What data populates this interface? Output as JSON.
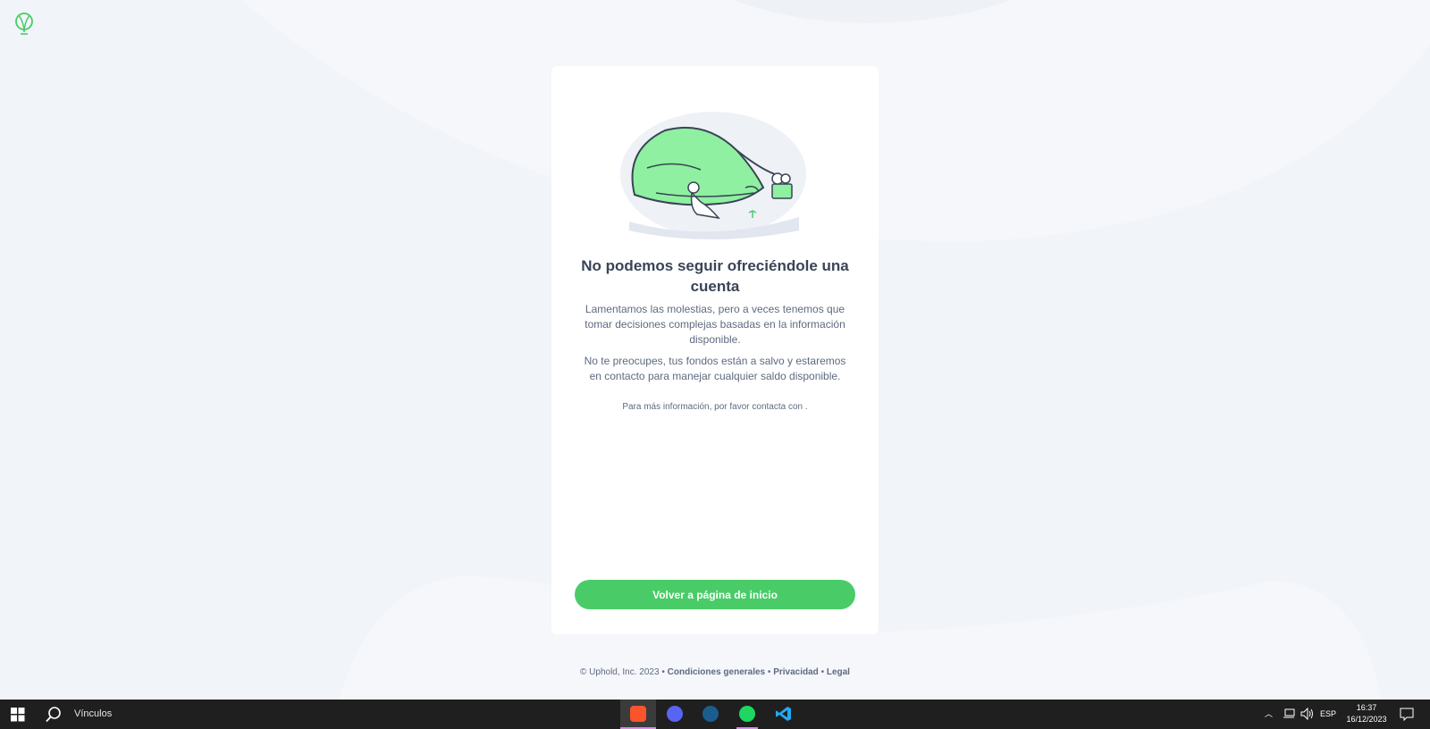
{
  "brand": {
    "name": "Uphold",
    "accent": "#49cc68"
  },
  "card": {
    "title": "No podemos seguir ofreciéndole una cuenta",
    "paragraph1": "Lamentamos las molestias, pero a veces tenemos que tomar decisiones complejas basadas en la información disponible.",
    "paragraph2": "No te preocupes, tus fondos están a salvo y estaremos en contacto para manejar cualquier saldo disponible.",
    "contact_note": "Para más información, por favor contacta con .",
    "button_label": "Volver a página de inicio"
  },
  "footer": {
    "copyright": "© Uphold, Inc. 2023",
    "separator": "•",
    "links": [
      "Condiciones generales",
      "Privacidad",
      "Legal"
    ]
  },
  "taskbar": {
    "search_label": "Vínculos",
    "apps": [
      {
        "name": "brave",
        "icon": "brave-icon",
        "color": "#fb542b",
        "active": true
      },
      {
        "name": "discord",
        "icon": "discord-icon",
        "color": "#5865f2",
        "active": false
      },
      {
        "name": "steam",
        "icon": "steam-icon",
        "color": "#1b5d8c",
        "active": false
      },
      {
        "name": "spotify",
        "icon": "spotify-icon",
        "color": "#1ed760",
        "active": false
      },
      {
        "name": "vscode",
        "icon": "vscode-icon",
        "color": "#23a9f2",
        "active": false
      }
    ],
    "language": "ESP",
    "time": "16:37",
    "date": "16/12/2023"
  }
}
